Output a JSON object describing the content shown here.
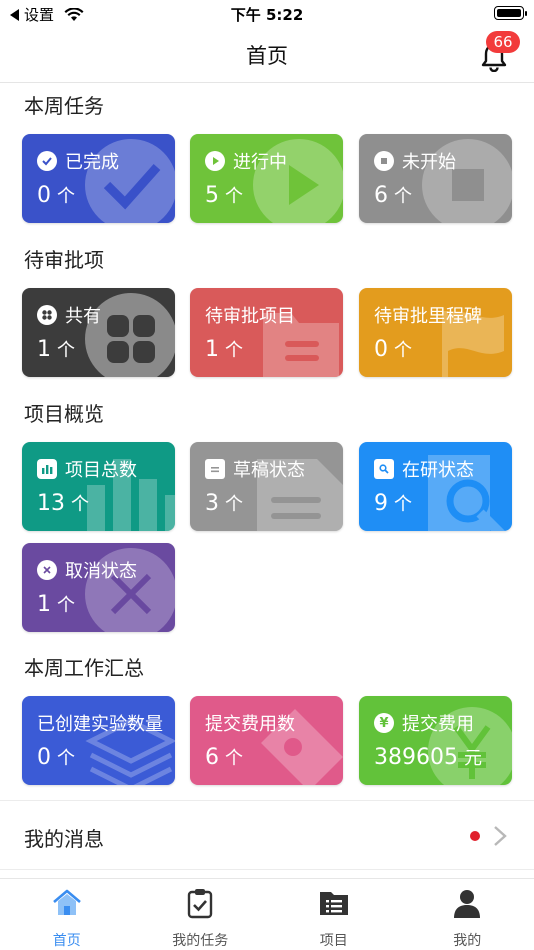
{
  "status_bar": {
    "back_label": "设置",
    "time": "下午 5:22"
  },
  "header": {
    "title": "首页",
    "notification_count": "66"
  },
  "sections": {
    "weekly_tasks": {
      "title": "本周任务",
      "cards": [
        {
          "label": "已完成",
          "value": "0",
          "unit": "个",
          "color": "#3a52c9",
          "icon": "check-circle-icon"
        },
        {
          "label": "进行中",
          "value": "5",
          "unit": "个",
          "color": "#6fc33a",
          "icon": "play-circle-icon"
        },
        {
          "label": "未开始",
          "value": "6",
          "unit": "个",
          "color": "#8f8f8f",
          "icon": "stop-circle-icon"
        }
      ]
    },
    "pending_approval": {
      "title": "待审批项",
      "cards": [
        {
          "label": "共有",
          "value": "1",
          "unit": "个",
          "color": "#3c3c3c",
          "icon": "grid-icon"
        },
        {
          "label": "待审批项目",
          "value": "1",
          "unit": "个",
          "color": "#d95a5a",
          "icon": "folder-icon"
        },
        {
          "label": "待审批里程碑",
          "value": "0",
          "unit": "个",
          "color": "#e39c1e",
          "icon": "flag-icon"
        }
      ]
    },
    "project_overview": {
      "title": "项目概览",
      "cards": [
        {
          "label": "项目总数",
          "value": "13",
          "unit": "个",
          "color": "#0f9a85",
          "icon": "bar-chart-icon"
        },
        {
          "label": "草稿状态",
          "value": "3",
          "unit": "个",
          "color": "#959595",
          "icon": "document-icon"
        },
        {
          "label": "在研状态",
          "value": "9",
          "unit": "个",
          "color": "#1f8ef5",
          "icon": "search-document-icon"
        },
        {
          "label": "取消状态",
          "value": "1",
          "unit": "个",
          "color": "#6a4aa0",
          "icon": "cancel-circle-icon"
        }
      ]
    },
    "weekly_summary": {
      "title": "本周工作汇总",
      "cards": [
        {
          "label": "已创建实验数量",
          "value": "0",
          "unit": "个",
          "color": "#3b5bd6",
          "icon": "layers-icon"
        },
        {
          "label": "提交费用数",
          "value": "6",
          "unit": "个",
          "color": "#e05a8a",
          "icon": "tag-icon"
        },
        {
          "label": "提交费用",
          "value": "389605",
          "unit": "元",
          "color": "#62c23a",
          "icon": "yen-icon"
        }
      ]
    }
  },
  "messages": {
    "label": "我的消息"
  },
  "tab_bar": {
    "tabs": [
      {
        "label": "首页",
        "icon": "home-icon",
        "active": true
      },
      {
        "label": "我的任务",
        "icon": "clipboard-check-icon",
        "active": false
      },
      {
        "label": "项目",
        "icon": "project-list-icon",
        "active": false
      },
      {
        "label": "我的",
        "icon": "person-icon",
        "active": false
      }
    ]
  }
}
